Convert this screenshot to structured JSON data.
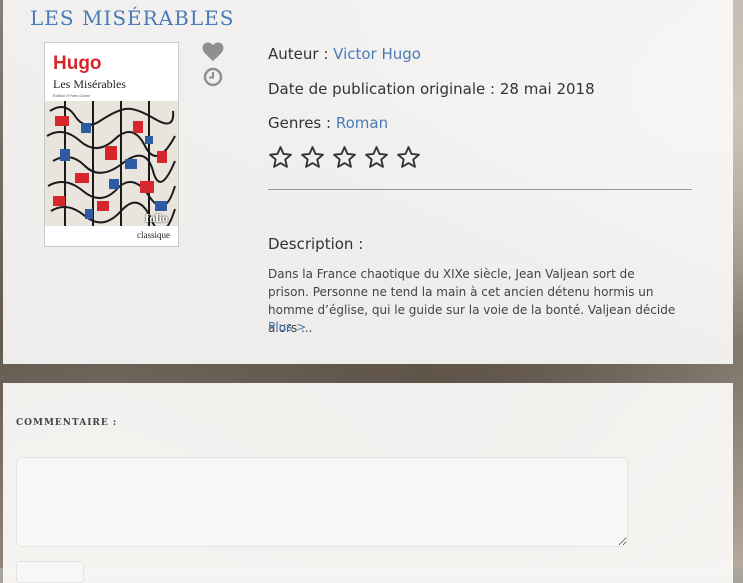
{
  "book": {
    "title": "LES MISÉRABLES",
    "cover": {
      "author": "Hugo",
      "title": "Les Misérables",
      "subtitle": "Édition d'Yves Gohin",
      "brand": "folio",
      "collection": "classique"
    },
    "author_label": "Auteur : ",
    "author_value": "Victor Hugo",
    "date_label": "Date de publication originale : ",
    "date_value": "28 mai 2018",
    "genres_label": "Genres : ",
    "genres_value": "Roman",
    "rating": {
      "filled": 0,
      "max": 5
    },
    "description_label": "Description :",
    "description_text": "Dans la France chaotique du XIXe siècle, Jean Valjean sort de prison. Personne ne tend la main à cet ancien détenu hormis un homme d’église, qui le guide sur la voie de la bonté. Valjean décide alors ...",
    "more_label": "Plus >"
  },
  "icons": {
    "favorite": "heart-icon",
    "read_later": "clock-icon",
    "star": "star-outline-icon"
  },
  "comment": {
    "label": "COMMENTAIRE :",
    "value": "",
    "placeholder": ""
  },
  "colors": {
    "accent": "#4a7bb7",
    "cover_author": "#d8262d"
  }
}
